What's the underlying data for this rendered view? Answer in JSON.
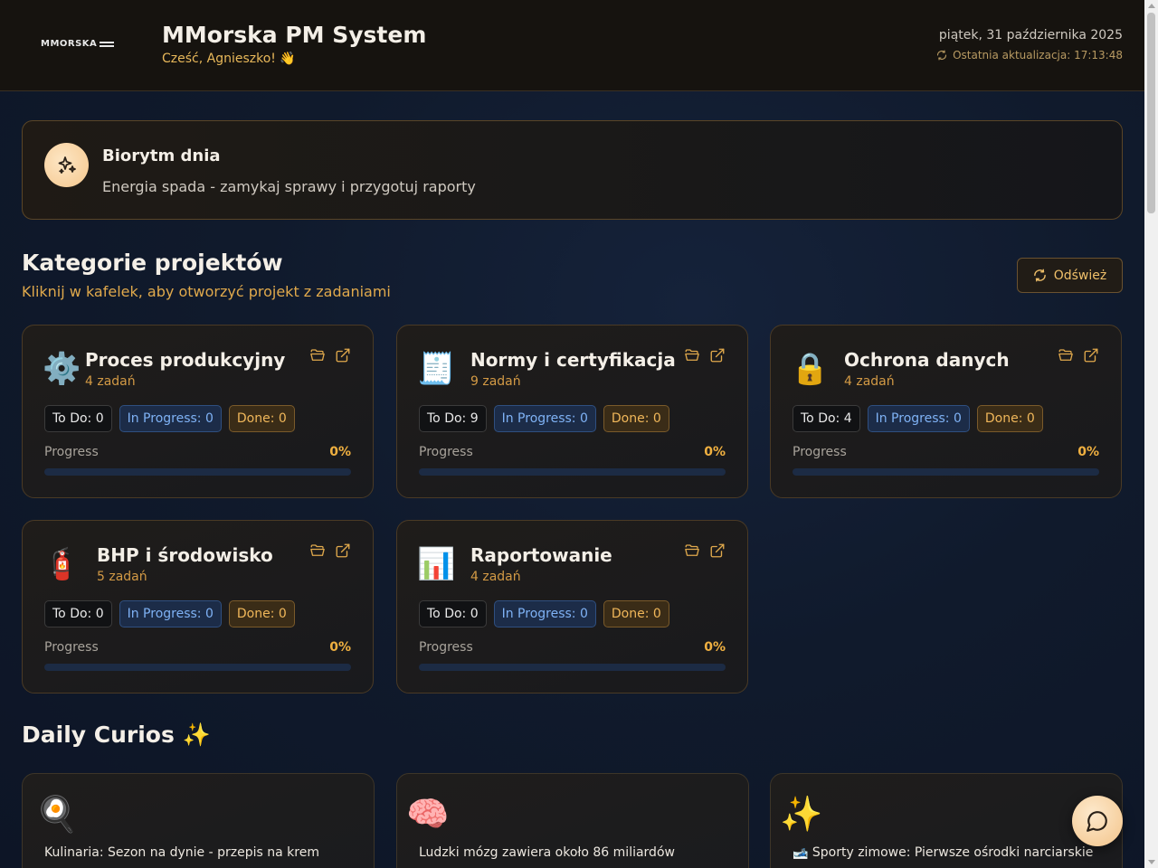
{
  "header": {
    "logo_text": "MMORSKA",
    "app_title": "MMorska PM System",
    "greeting": "Cześć, Agnieszko! 👋",
    "date": "piątek, 31 października 2025",
    "last_update": "Ostatnia aktualizacja: 17:13:48"
  },
  "biorhythm": {
    "title": "Biorytm dnia",
    "text": "Energia spada - zamykaj sprawy i przygotuj raporty",
    "icon": "sparkles-icon"
  },
  "categories_section": {
    "title": "Kategorie projektów",
    "subtitle": "Kliknij w kafelek, aby otworzyć projekt z zadaniami",
    "refresh_label": "Odśwież"
  },
  "categories": [
    {
      "emoji": "⚙️",
      "title": "Proces produkcyjny",
      "count": "4 zadań",
      "todo": "To Do: 0",
      "in_progress": "In Progress: 0",
      "done": "Done: 0",
      "progress_label": "Progress",
      "progress_value": "0%",
      "progress_fraction": 0
    },
    {
      "emoji": "🧾",
      "title": "Normy i certyfikacja",
      "count": "9 zadań",
      "todo": "To Do: 9",
      "in_progress": "In Progress: 0",
      "done": "Done: 0",
      "progress_label": "Progress",
      "progress_value": "0%",
      "progress_fraction": 0
    },
    {
      "emoji": "🔒",
      "title": "Ochrona danych",
      "count": "4 zadań",
      "todo": "To Do: 4",
      "in_progress": "In Progress: 0",
      "done": "Done: 0",
      "progress_label": "Progress",
      "progress_value": "0%",
      "progress_fraction": 0
    },
    {
      "emoji": "🧯",
      "title": "BHP i środowisko",
      "count": "5 zadań",
      "todo": "To Do: 0",
      "in_progress": "In Progress: 0",
      "done": "Done: 0",
      "progress_label": "Progress",
      "progress_value": "0%",
      "progress_fraction": 0
    },
    {
      "emoji": "📊",
      "title": "Raportowanie",
      "count": "4 zadań",
      "todo": "To Do: 0",
      "in_progress": "In Progress: 0",
      "done": "Done: 0",
      "progress_label": "Progress",
      "progress_value": "0%",
      "progress_fraction": 0
    }
  ],
  "curios_section": {
    "title": "Daily Curios ✨"
  },
  "curios": [
    {
      "emoji": "🍳",
      "text": "Kulinaria: Sezon na dynie - przepis na krem"
    },
    {
      "emoji": "🧠",
      "text": "Ludzki mózg zawiera około 86 miliardów"
    },
    {
      "emoji": "✨",
      "text": "🎿 Sporty zimowe: Pierwsze ośrodki narciarskie"
    }
  ],
  "colors": {
    "accent": "#f0b040",
    "in_progress": "#7fb2f5",
    "background": "#101a2c"
  },
  "chat_button_icon": "chat-bubble-icon"
}
